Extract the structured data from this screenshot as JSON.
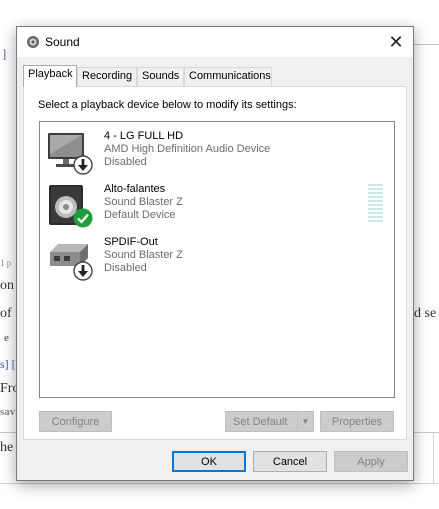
{
  "window": {
    "title": "Sound",
    "close_glyph": "✕"
  },
  "tabs": [
    {
      "label": "Playback"
    },
    {
      "label": "Recording"
    },
    {
      "label": "Sounds"
    },
    {
      "label": "Communications"
    }
  ],
  "instruction": "Select a playback device below to modify its settings:",
  "devices": [
    {
      "name": "4 - LG FULL HD",
      "driver": "AMD High Definition Audio Device",
      "status": "Disabled",
      "icon": "monitor-icon",
      "badge": "disabled-arrow-icon"
    },
    {
      "name": "Alto-falantes",
      "driver": "Sound Blaster Z",
      "status": "Default Device",
      "icon": "speaker-icon",
      "badge": "default-check-icon",
      "level": 0
    },
    {
      "name": "SPDIF-Out",
      "driver": "Sound Blaster Z",
      "status": "Disabled",
      "icon": "digital-output-icon",
      "badge": "disabled-arrow-icon"
    }
  ],
  "panel_buttons": {
    "configure": "Configure",
    "set_default": "Set Default",
    "properties": "Properties"
  },
  "dialog_buttons": {
    "ok": "OK",
    "cancel": "Cancel",
    "apply": "Apply"
  },
  "background_fragments": {
    "frag1": "]",
    "frag2": "1 p",
    "frag3": "on",
    "frag4": "of",
    "frag5": "d se",
    "frag6": "e",
    "frag7": "s] [",
    "frag8": "Fro",
    "frag9": "sav",
    "frag10": "he"
  },
  "colors": {
    "accent": "#0078d7",
    "check": "#1e9e3c",
    "meter": "#c9e8e6"
  }
}
